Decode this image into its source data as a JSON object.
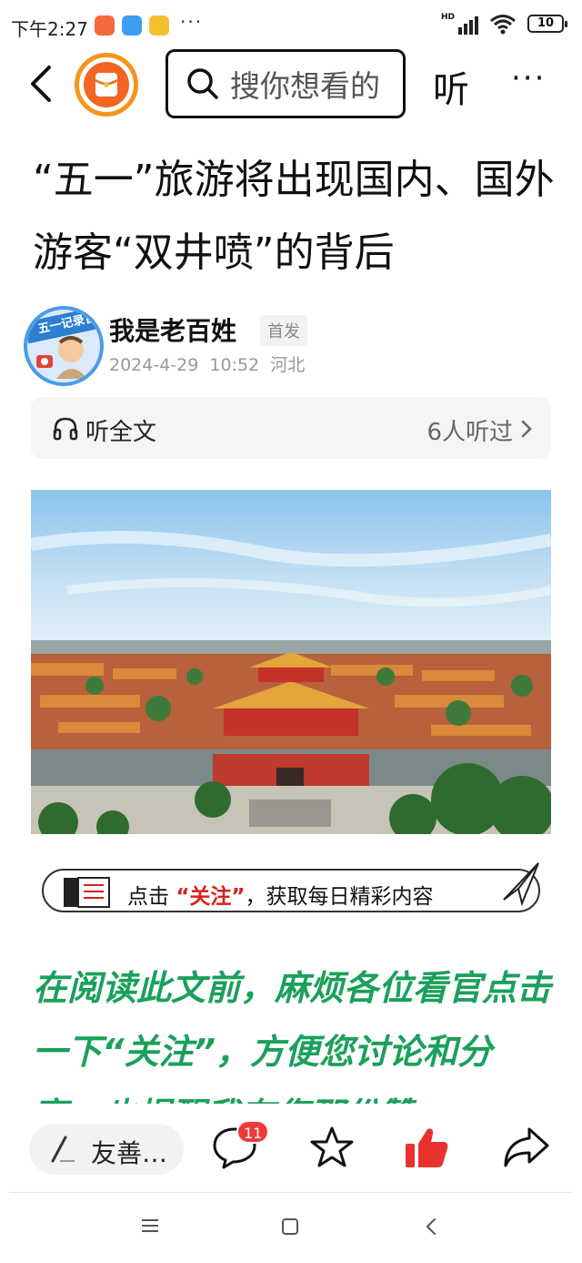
{
  "status_bar": {
    "time": "下午2:27",
    "more_dots": "···",
    "network_label": "HD",
    "battery": "10"
  },
  "nav": {
    "search_placeholder": "搜你想看的",
    "listen_label": "听",
    "more_label": "···"
  },
  "article": {
    "headline": "“五一”旅游将出现国内、国外游客“双井喷”的背后",
    "author": {
      "name": "我是老百姓",
      "badge": "首发",
      "date": "2024-4-29",
      "time": "10:52",
      "location": "河北",
      "avatar_ribbon": "五一记录官"
    },
    "listen_bar": {
      "label": "听全文",
      "count": "6人听过"
    },
    "follow_banner": {
      "prefix": "点击",
      "highlight": "“关注”",
      "suffix": "，获取每日精彩内容"
    },
    "body_text": "在阅读此文前，麻烦各位看官点击一下“关注”，方便您讨论和分享，也提醒我有您那份赞"
  },
  "action_bar": {
    "comment_placeholder": "友善…",
    "comment_count": "11"
  },
  "colors": {
    "accent_orange": "#f7941d",
    "like_red": "#e8322f",
    "body_green": "#1aa05a",
    "badge_red": "#ee3a3a"
  }
}
